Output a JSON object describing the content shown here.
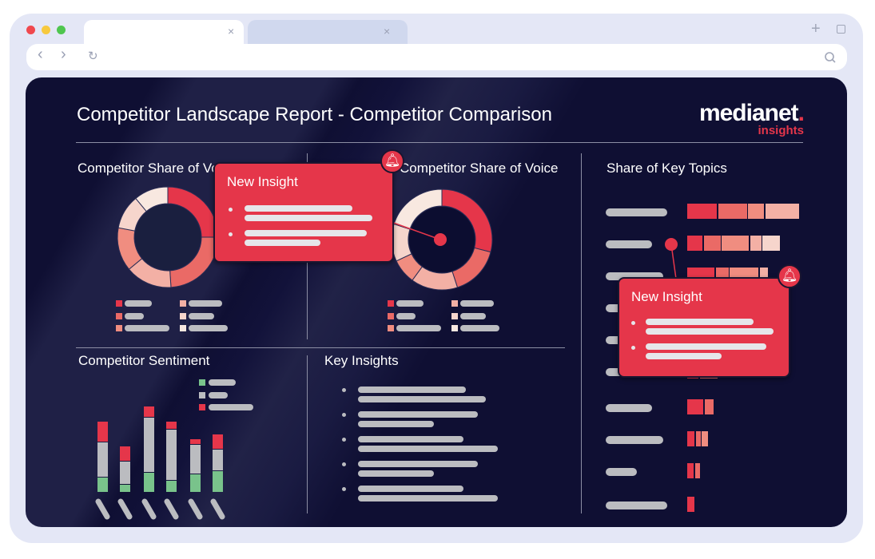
{
  "browser": {
    "tab_close_icon": "×",
    "nav_back": "‹",
    "nav_forward": "›",
    "reload": "↻",
    "new_tab": "+",
    "search_icon": "search"
  },
  "report": {
    "title": "Competitor Landscape Report - Competitor Comparison",
    "logo": {
      "text": "medianet",
      "sub": "insights"
    },
    "sections": {
      "sov1": "Competitor Share of Voice",
      "sov2": "Competitor Share of Voice",
      "topics": "Share of Key Topics",
      "sentiment": "Competitor Sentiment",
      "insights": "Key Insights"
    }
  },
  "popups": [
    {
      "title": "New Insight",
      "icon": "bell-icon"
    },
    {
      "title": "New Insight",
      "icon": "bell-icon"
    }
  ],
  "colors": {
    "accent": "#e5364a",
    "background": "#0f0f33",
    "positive": "#79c38b",
    "neutral": "#bbbcc0",
    "negative": "#e5364a",
    "palette": [
      "#e5364a",
      "#ea6a66",
      "#f08d80",
      "#f3b0a5",
      "#f6d5cc",
      "#f8e8e0"
    ]
  },
  "donuts": [
    {
      "segments": [
        25,
        24,
        15,
        14,
        11,
        11
      ],
      "order": [
        0,
        1,
        3,
        2,
        4,
        5
      ]
    },
    {
      "segments": [
        29,
        16,
        15,
        8,
        12,
        20
      ],
      "order": [
        0,
        1,
        3,
        2,
        4,
        5
      ]
    }
  ],
  "sentiment": {
    "bars": [
      {
        "positive": 19,
        "neutral": 44,
        "negative": 26
      },
      {
        "positive": 10,
        "neutral": 29,
        "negative": 19
      },
      {
        "positive": 25,
        "neutral": 69,
        "negative": 14
      },
      {
        "positive": 15,
        "neutral": 64,
        "negative": 10
      },
      {
        "positive": 23,
        "neutral": 37,
        "negative": 7
      },
      {
        "positive": 27,
        "neutral": 27,
        "negative": 19
      }
    ]
  },
  "topics": {
    "rows": [
      [
        37,
        36,
        20,
        42
      ],
      [
        19,
        21,
        34,
        14,
        22
      ],
      [
        34,
        16,
        36,
        10
      ],
      [],
      [],
      [
        14,
        22
      ],
      [
        20,
        11
      ],
      [
        9,
        6,
        8
      ],
      [
        8,
        6
      ],
      [
        9
      ]
    ]
  }
}
